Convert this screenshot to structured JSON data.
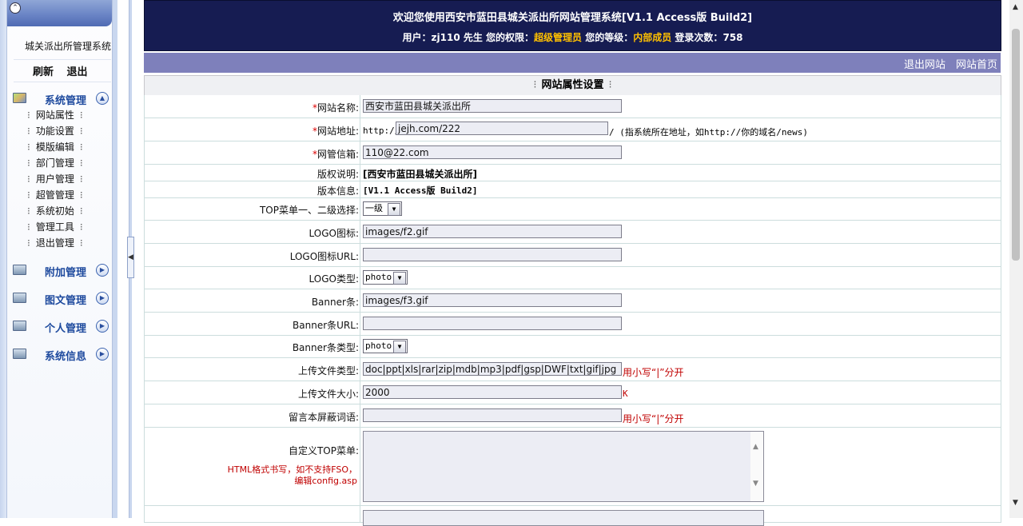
{
  "sidebar": {
    "system_name": "城关派出所管理系统",
    "refresh": "刷新",
    "logout": "退出",
    "groups": [
      {
        "label": "系统管理",
        "icon": "tools-icon"
      },
      {
        "label": "附加管理",
        "icon": "folder-icon"
      },
      {
        "label": "图文管理",
        "icon": "folder-icon"
      },
      {
        "label": "个人管理",
        "icon": "folder-icon"
      },
      {
        "label": "系统信息",
        "icon": "folder-icon"
      }
    ],
    "items": [
      "网站属性",
      "功能设置",
      "模版编辑",
      "部门管理",
      "用户管理",
      "超管管理",
      "系统初始",
      "管理工具",
      "退出管理"
    ],
    "item_dot": "⁝"
  },
  "header": {
    "welcome": "欢迎您使用西安市蓝田县城关派出所网站管理系统[V1.1 Access版 Build2]",
    "user_prefix": "用户：",
    "user_name": "zj110",
    "user_suffix": " 先生  您的权限：",
    "role": "超级管理员",
    "level_label": " 您的等级：",
    "level": "内部成员",
    "login_label": " 登录次数：",
    "login_count": "758"
  },
  "nav": {
    "exit_site": "退出网站",
    "home": "网站首页"
  },
  "form": {
    "title": "网站属性设置",
    "title_dots": "⁝",
    "req_mark": "*",
    "site_name": {
      "label": "网站名称:",
      "value": "西安市蓝田县城关派出所"
    },
    "site_url": {
      "label": "网站地址:",
      "prefix": "http://",
      "value": "jejh.com/222",
      "hint": "/ (指系统所在地址，如http://你的域名/news)"
    },
    "admin_email": {
      "label": "网管信箱:",
      "value": "110@22.com"
    },
    "copyright": {
      "label": "版权说明:",
      "value": "[西安市蓝田县城关派出所]"
    },
    "version": {
      "label": "版本信息:",
      "value": "[V1.1 Access版 Build2]"
    },
    "top_menu_level": {
      "label": "TOP菜单一、二级选择:",
      "value": "一级"
    },
    "logo": {
      "label": "LOGO图标:",
      "value": "images/f2.gif"
    },
    "logo_url": {
      "label": "LOGO图标URL:",
      "value": ""
    },
    "logo_type": {
      "label": "LOGO类型:",
      "value": "photo"
    },
    "banner": {
      "label": "Banner条:",
      "value": "images/f3.gif"
    },
    "banner_url": {
      "label": "Banner条URL:",
      "value": ""
    },
    "banner_type": {
      "label": "Banner条类型:",
      "value": "photo"
    },
    "upload_types": {
      "label": "上传文件类型:",
      "value": "doc|ppt|xls|rar|zip|mdb|mp3|pdf|gsp|DWF|txt|gif|jpg",
      "note": "用小写“|”分开"
    },
    "upload_size": {
      "label": "上传文件大小:",
      "value": "2000",
      "note": "K"
    },
    "blocked_words": {
      "label": "留言本屏蔽词语:",
      "value": "",
      "note": "用小写“|”分开"
    },
    "custom_top_menu": {
      "label": "自定义TOP菜单:",
      "note": "HTML格式书写，如不支持FSO，编辑config.asp"
    }
  }
}
